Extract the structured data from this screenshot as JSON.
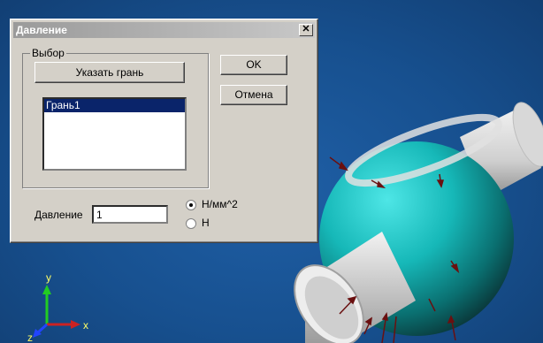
{
  "dialog": {
    "title": "Давление",
    "close_glyph": "✕",
    "group_label": "Выбор",
    "select_face_label": "Указать грань",
    "faces": [
      "Грань1"
    ],
    "ok_label": "OK",
    "cancel_label": "Отмена",
    "pressure_label": "Давление",
    "pressure_value": "1",
    "units": [
      {
        "label": "Н/мм^2",
        "checked": true
      },
      {
        "label": "Н",
        "checked": false
      }
    ]
  },
  "viewport": {
    "axes": {
      "x": "x",
      "y": "y",
      "z": "z"
    },
    "colors": {
      "background": "#1a4d8c",
      "sphere": "#1ac6c6",
      "shaft": "#e6e6e6",
      "arrow": "#6a1010"
    }
  }
}
